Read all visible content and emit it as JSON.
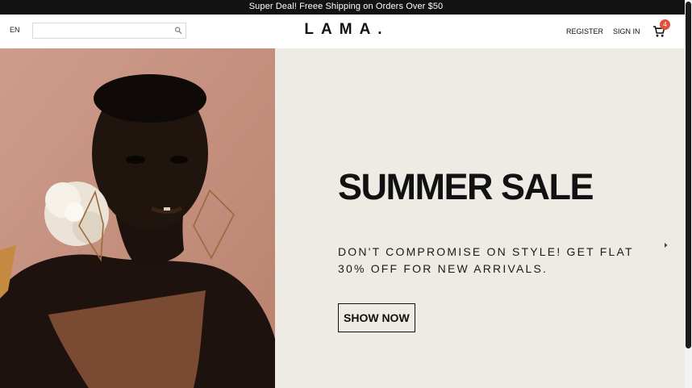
{
  "announcement": "Super Deal! Freee Shipping on Orders Over $50",
  "navbar": {
    "language": "EN",
    "search": {
      "value": "",
      "placeholder": ""
    },
    "logo": "LAMA.",
    "register_label": "REGISTER",
    "signin_label": "SIGN IN",
    "cart_count": "4",
    "cart_icon": "shopping-cart-icon"
  },
  "hero": {
    "title": "SUMMER SALE",
    "description": "DON'T COMPROMISE ON STYLE! GET FLAT 30% OFF FOR NEW ARRIVALS.",
    "button_label": "SHOW NOW",
    "arrow_icon": "chevron-right-icon",
    "image_subject": "model-portrait"
  },
  "colors": {
    "announcement_bg": "#121212",
    "hero_right_bg": "#eeebe4",
    "hero_image_bg": "#c79383",
    "badge": "#e0513a"
  }
}
